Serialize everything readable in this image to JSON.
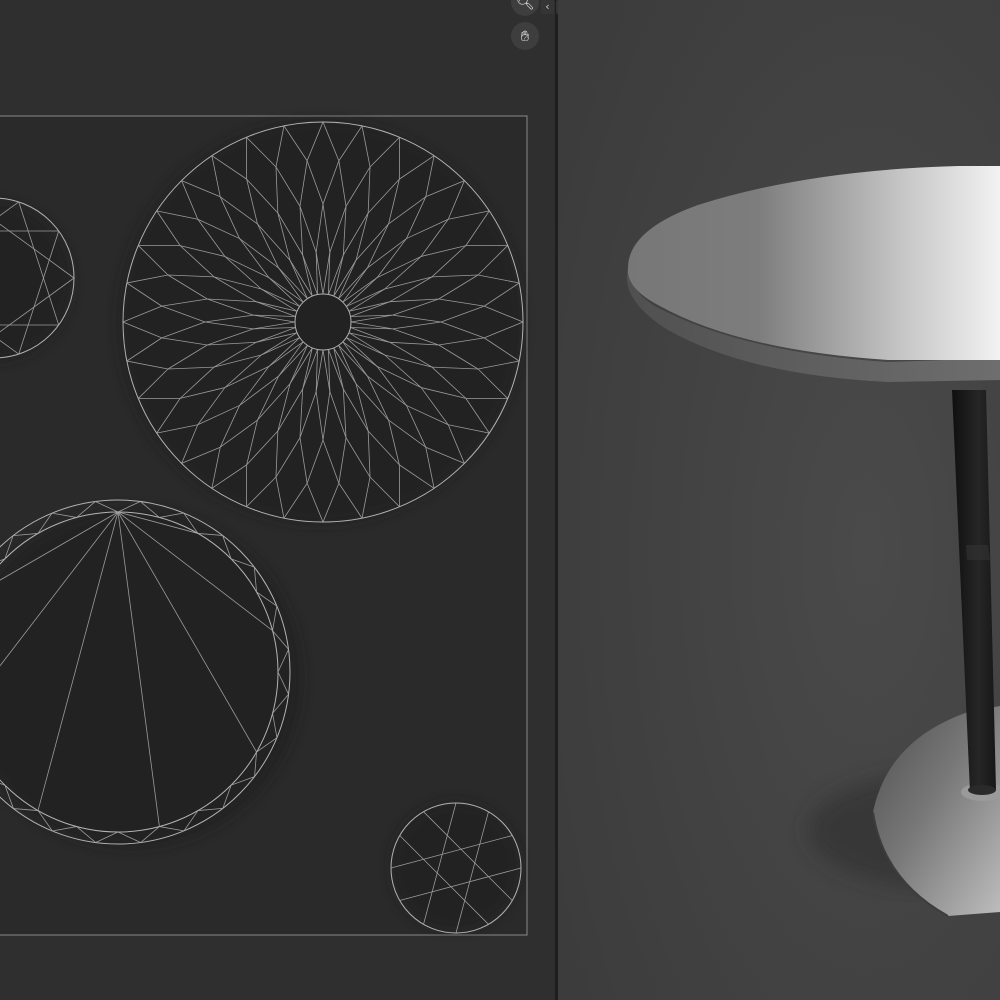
{
  "uv_editor": {
    "navigation": {
      "zoom_icon": "magnifier-icon",
      "pan_icon": "hand-icon"
    },
    "colors": {
      "background": "#2f2f2f",
      "uv_bounds": "#2a2a2a",
      "wire": "#b8b8b8"
    }
  },
  "area_split": {
    "left_arrow": "‹",
    "right_arrow": "›"
  },
  "viewport": {
    "object": "round-table",
    "colors": {
      "background": "#404040",
      "tabletop_light": "#e6e6e6",
      "pole": "#1c1c1c"
    }
  }
}
